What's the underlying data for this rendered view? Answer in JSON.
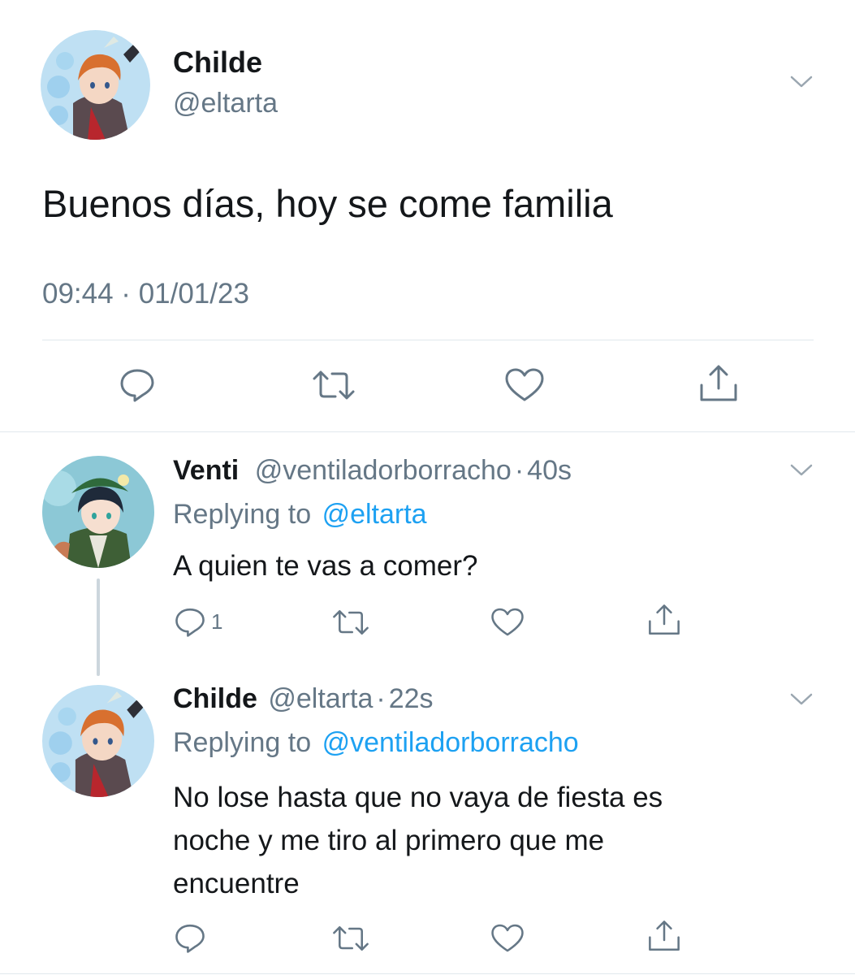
{
  "main_tweet": {
    "display_name": "Childe",
    "handle": "@eltarta",
    "text": "Buenos días, hoy se come familia",
    "timestamp": "09:44 · 01/01/23",
    "avatar_icon": "childe-avatar"
  },
  "replies": [
    {
      "display_name": "Venti",
      "handle": "@ventiladorborracho",
      "separator": "·",
      "age": "40s",
      "replying_prefix": "Replying to",
      "replying_to": "@eltarta",
      "text": "A quien te vas a comer?",
      "reply_count": "1",
      "avatar_icon": "venti-avatar"
    },
    {
      "display_name": "Childe",
      "handle": "@eltarta",
      "separator": "·",
      "age": "22s",
      "replying_prefix": "Replying to",
      "replying_to": "@ventiladorborracho",
      "text_lines": [
        "No lose hasta que no vaya de fiesta es",
        "noche y me tiro al primero que me",
        "encuentre"
      ],
      "reply_count": "",
      "avatar_icon": "childe-avatar"
    }
  ],
  "icons": [
    "chevron-down-icon",
    "reply-icon",
    "retweet-icon",
    "like-icon",
    "share-icon"
  ],
  "colors": {
    "link": "#1da1f2",
    "muted": "#657786",
    "text": "#14171a",
    "divider": "#e1e8ed",
    "thread_line": "#ccd6dd"
  }
}
